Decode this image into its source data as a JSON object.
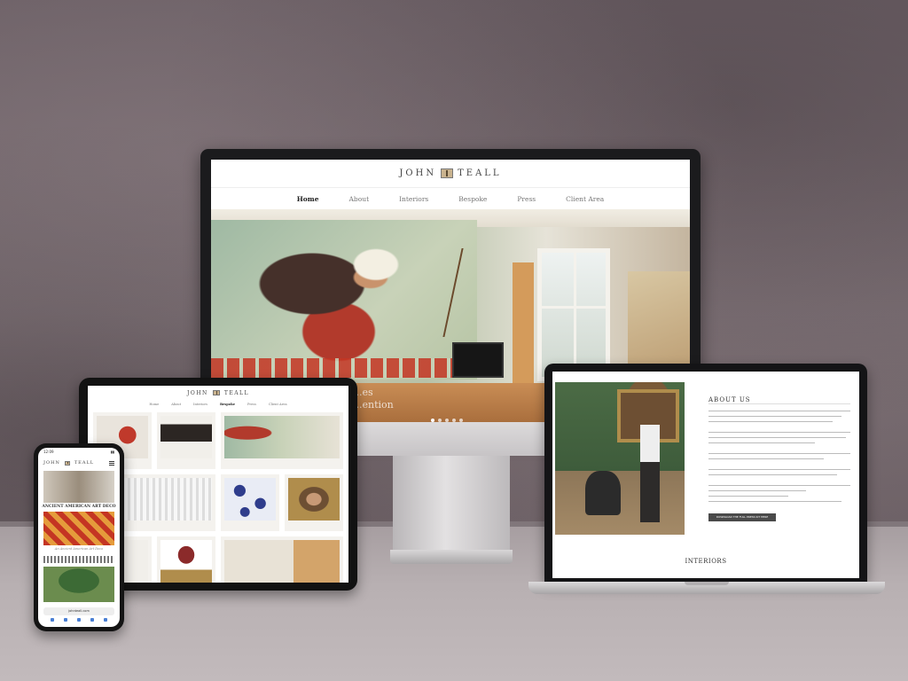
{
  "brand": {
    "name_left": "JOHN",
    "name_right": "TEALL"
  },
  "nav": {
    "home": "Home",
    "about": "About",
    "interiors": "Interiors",
    "bespoke": "Bespoke",
    "press": "Press",
    "client": "Client Area"
  },
  "hero": {
    "caption_line1": "...es",
    "caption_line2": "...ention"
  },
  "phone": {
    "time": "12:09",
    "section1": "ANCIENT AMERICAN ART DECO",
    "section1_sub": "An Ancient American Art Deco",
    "url": "johnteall.com"
  },
  "laptop": {
    "heading": "ABOUT US",
    "button": "DOWNLOAD THE FULL PRESS KIT HERE",
    "section": "INTERIORS"
  },
  "colors": {
    "accent": "#c43523",
    "wall": "#6f6469",
    "floor": "#b8b0b2"
  }
}
